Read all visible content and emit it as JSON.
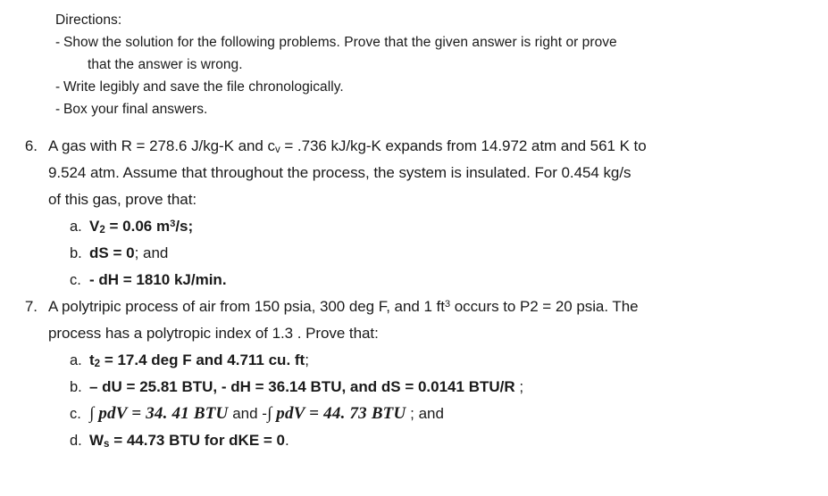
{
  "document": {
    "directions": {
      "heading": "Directions:",
      "items": [
        "Show the solution for the following problems. Prove that the given answer is right or prove",
        "Write legibly and save the file chronologically.",
        "Box your final answers."
      ],
      "item1_continuation": "that the answer is wrong."
    },
    "problems": [
      {
        "number": "6.",
        "text_line1_a": "A gas with R = 278.6 J/kg-K and c",
        "text_line1_sub": "v",
        "text_line1_b": " = .736 kJ/kg-K expands from 14.972 atm and 561 K to",
        "text_line2": "9.524 atm. Assume that throughout the process, the system is insulated. For 0.454 kg/s",
        "text_line3": "of this gas, prove that:",
        "subitems": [
          {
            "letter": "a.",
            "bold_lead": "V",
            "bold_lead_sub": "2",
            "bold_mid": " = 0.06 m",
            "bold_sup": "3",
            "bold_tail": "/s;",
            "plain_tail": ""
          },
          {
            "letter": "b.",
            "bold_lead": "dS = 0",
            "plain_tail": "; and"
          },
          {
            "letter": "c.",
            "bold_lead": "- dH = 1810 kJ/min.",
            "plain_tail": ""
          }
        ]
      },
      {
        "number": "7.",
        "text_line1_a": "A polytripic process of air from 150 psia, 300 deg F, and 1 ft",
        "text_line1_sup": "3",
        "text_line1_b": " occurs to P2 = 20 psia. The",
        "text_line2": "process has a polytropic index of 1.3 . Prove that:",
        "subitems": [
          {
            "letter": "a.",
            "bold_lead": "t",
            "bold_lead_sub": "2",
            "bold_mid": " = 17.4 deg F and 4.711 cu. ft",
            "plain_tail": ";"
          },
          {
            "letter": "b.",
            "bold_lead": "– dU = 25.81 BTU, - dH = 36.14 BTU, and dS = 0.0141 BTU/R",
            "plain_tail": " ;"
          },
          {
            "letter": "c.",
            "math_1": "∫ pdV = 34. 41 BTU",
            "plain_mid": " and -",
            "math_2": "∫ pdV = 44. 73 BTU",
            "plain_tail": " ; and"
          },
          {
            "letter": "d.",
            "bold_lead": "W",
            "bold_lead_sub": "s",
            "bold_mid": " = 44.73 BTU for dKE = 0",
            "plain_tail": "."
          }
        ]
      }
    ]
  },
  "colors": {
    "page_background": "#ffffff",
    "text": "#1a1a1a"
  }
}
